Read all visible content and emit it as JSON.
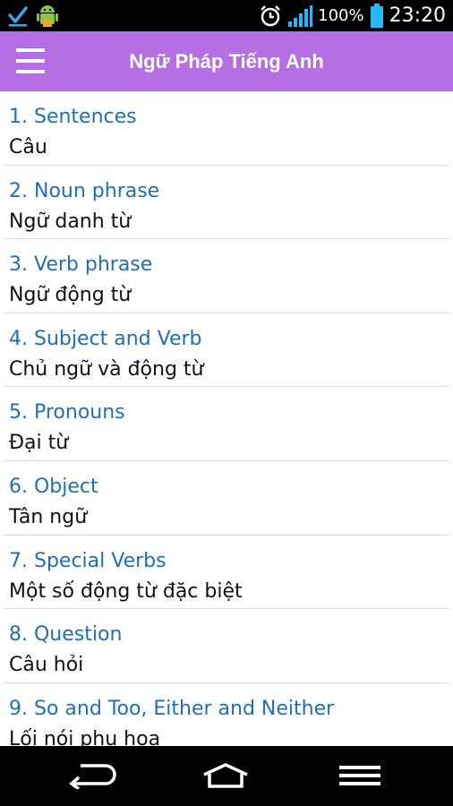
{
  "status_bar": {
    "battery_text": "100%",
    "time": "23:20",
    "icons": [
      "check-icon",
      "android-icon",
      "alarm-icon",
      "signal-icon",
      "battery-icon"
    ]
  },
  "app_bar": {
    "title": "Ngữ Pháp Tiếng Anh",
    "menu_icon": "hamburger-menu-icon",
    "color": "#b56ee3"
  },
  "list": {
    "title_color": "#1f6fb2",
    "items": [
      {
        "title": "1. Sentences",
        "subtitle": "Câu"
      },
      {
        "title": "2. Noun phrase",
        "subtitle": "Ngữ danh từ"
      },
      {
        "title": "3. Verb phrase",
        "subtitle": "Ngữ động từ"
      },
      {
        "title": "4. Subject and Verb",
        "subtitle": "Chủ ngữ và động từ"
      },
      {
        "title": "5. Pronouns",
        "subtitle": "Đại từ"
      },
      {
        "title": "6. Object",
        "subtitle": "Tân ngữ"
      },
      {
        "title": "7. Special Verbs",
        "subtitle": "Một số động từ đặc biệt"
      },
      {
        "title": "8. Question",
        "subtitle": "Câu hỏi"
      },
      {
        "title": "9. So and Too, Either and Neither",
        "subtitle": "Lối nói phụ họa"
      }
    ]
  },
  "nav_bar": {
    "buttons": [
      "back-icon",
      "home-icon",
      "menu-icon"
    ]
  }
}
